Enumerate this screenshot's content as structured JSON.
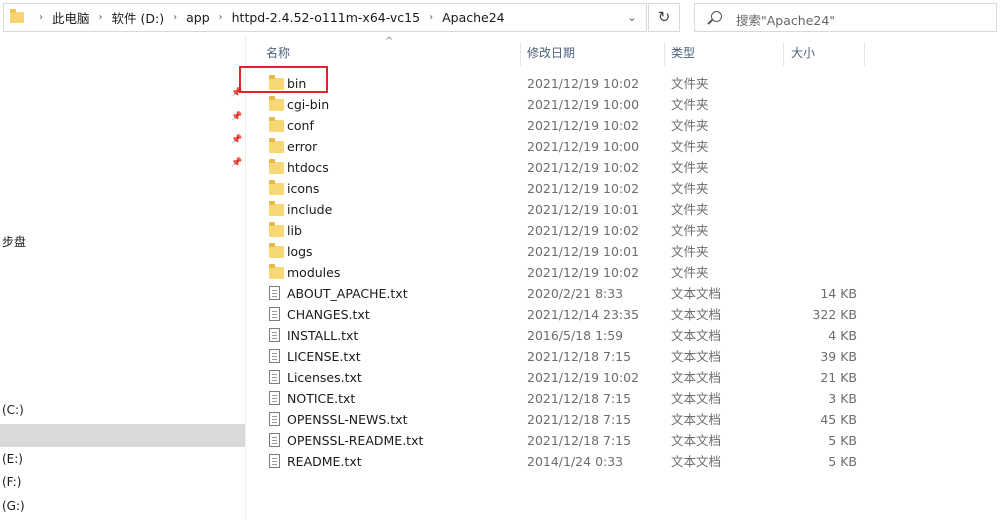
{
  "address_bar": {
    "crumbs": [
      "此电脑",
      "软件 (D:)",
      "app",
      "httpd-2.4.52-o111m-x64-vc15",
      "Apache24"
    ]
  },
  "search": {
    "placeholder": "搜索\"Apache24\""
  },
  "nav": {
    "items": [
      {
        "label": "步盘"
      },
      {
        "label": "(C:)"
      },
      {
        "label": ""
      },
      {
        "label": "(E:)"
      },
      {
        "label": "(F:)"
      },
      {
        "label": "(G:)"
      }
    ]
  },
  "columns": {
    "name": "名称",
    "date": "修改日期",
    "type": "类型",
    "size": "大小"
  },
  "files": [
    {
      "name": "bin",
      "date": "2021/12/19 10:02",
      "type": "文件夹",
      "size": "",
      "icon": "folder-icon"
    },
    {
      "name": "cgi-bin",
      "date": "2021/12/19 10:00",
      "type": "文件夹",
      "size": "",
      "icon": "folder-icon"
    },
    {
      "name": "conf",
      "date": "2021/12/19 10:02",
      "type": "文件夹",
      "size": "",
      "icon": "folder-icon"
    },
    {
      "name": "error",
      "date": "2021/12/19 10:00",
      "type": "文件夹",
      "size": "",
      "icon": "folder-icon"
    },
    {
      "name": "htdocs",
      "date": "2021/12/19 10:02",
      "type": "文件夹",
      "size": "",
      "icon": "folder-icon"
    },
    {
      "name": "icons",
      "date": "2021/12/19 10:02",
      "type": "文件夹",
      "size": "",
      "icon": "folder-icon"
    },
    {
      "name": "include",
      "date": "2021/12/19 10:01",
      "type": "文件夹",
      "size": "",
      "icon": "folder-icon"
    },
    {
      "name": "lib",
      "date": "2021/12/19 10:02",
      "type": "文件夹",
      "size": "",
      "icon": "folder-icon"
    },
    {
      "name": "logs",
      "date": "2021/12/19 10:01",
      "type": "文件夹",
      "size": "",
      "icon": "folder-icon"
    },
    {
      "name": "modules",
      "date": "2021/12/19 10:02",
      "type": "文件夹",
      "size": "",
      "icon": "folder-icon"
    },
    {
      "name": "ABOUT_APACHE.txt",
      "date": "2020/2/21 8:33",
      "type": "文本文档",
      "size": "14 KB",
      "icon": "text-file-icon"
    },
    {
      "name": "CHANGES.txt",
      "date": "2021/12/14 23:35",
      "type": "文本文档",
      "size": "322 KB",
      "icon": "text-file-icon"
    },
    {
      "name": "INSTALL.txt",
      "date": "2016/5/18 1:59",
      "type": "文本文档",
      "size": "4 KB",
      "icon": "text-file-icon"
    },
    {
      "name": "LICENSE.txt",
      "date": "2021/12/18 7:15",
      "type": "文本文档",
      "size": "39 KB",
      "icon": "text-file-icon"
    },
    {
      "name": "Licenses.txt",
      "date": "2021/12/19 10:02",
      "type": "文本文档",
      "size": "21 KB",
      "icon": "text-file-icon"
    },
    {
      "name": "NOTICE.txt",
      "date": "2021/12/18 7:15",
      "type": "文本文档",
      "size": "3 KB",
      "icon": "text-file-icon"
    },
    {
      "name": "OPENSSL-NEWS.txt",
      "date": "2021/12/18 7:15",
      "type": "文本文档",
      "size": "45 KB",
      "icon": "text-file-icon"
    },
    {
      "name": "OPENSSL-README.txt",
      "date": "2021/12/18 7:15",
      "type": "文本文档",
      "size": "5 KB",
      "icon": "text-file-icon"
    },
    {
      "name": "README.txt",
      "date": "2014/1/24 0:33",
      "type": "文本文档",
      "size": "5 KB",
      "icon": "text-file-icon"
    }
  ],
  "highlight_color": "#e0242b"
}
